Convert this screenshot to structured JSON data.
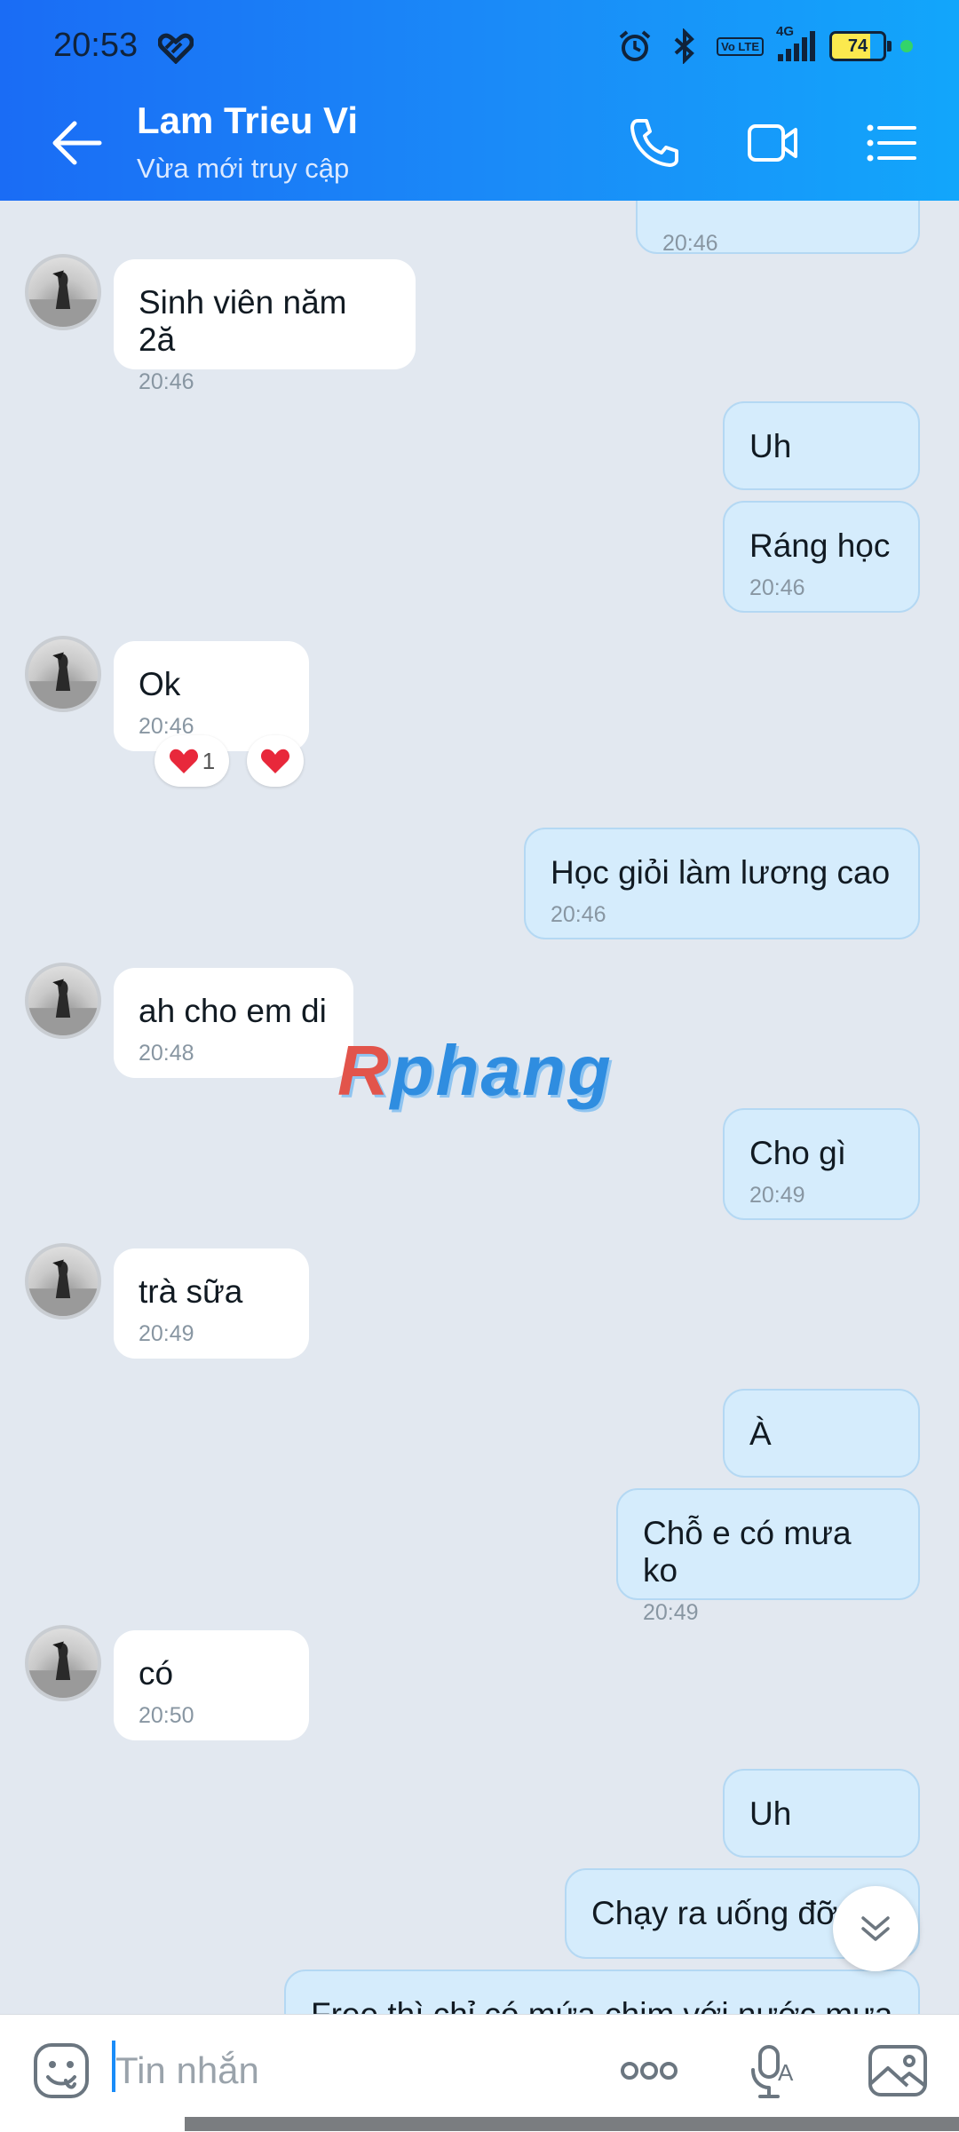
{
  "status_bar": {
    "time": "20:53",
    "network": "4G",
    "volte": "Vo LTE",
    "battery": "74"
  },
  "header": {
    "contact_name": "Lam Trieu Vi",
    "contact_status": "Vừa mới truy cập"
  },
  "messages": [
    {
      "side": "sent",
      "text": "",
      "time": "20:46"
    },
    {
      "side": "recv",
      "text": "Sinh viên năm 2ă",
      "time": "20:46"
    },
    {
      "side": "sent",
      "text": "Uh",
      "time": ""
    },
    {
      "side": "sent",
      "text": "Ráng học",
      "time": "20:46"
    },
    {
      "side": "recv",
      "text": "Ok",
      "time": "20:46",
      "reactions": [
        "❤️ 1",
        "❤️"
      ]
    },
    {
      "side": "sent",
      "text": "Học giỏi làm lương cao",
      "time": "20:46"
    },
    {
      "side": "recv",
      "text": "ah cho em di",
      "time": "20:48"
    },
    {
      "side": "sent",
      "text": "Cho gì",
      "time": "20:49"
    },
    {
      "side": "recv",
      "text": "trà sữa",
      "time": "20:49"
    },
    {
      "side": "sent",
      "text": "À",
      "time": ""
    },
    {
      "side": "sent",
      "text": "Chỗ e có mưa ko",
      "time": "20:49"
    },
    {
      "side": "recv",
      "text": "có",
      "time": "20:50"
    },
    {
      "side": "sent",
      "text": "Uh",
      "time": ""
    },
    {
      "side": "sent",
      "text": "Chạy ra uống đỡ",
      "time": ""
    },
    {
      "side": "sent",
      "text": "Free thì chỉ có mứa chim với nước mưa",
      "time": ""
    }
  ],
  "reaction_count": "1",
  "watermark": {
    "first": "R",
    "rest": "phang"
  },
  "composer": {
    "placeholder": "Tin nhắn"
  },
  "colors": {
    "header_start": "#1a6cf5",
    "header_end": "#12a6fb",
    "chat_bg": "#e2e8f0",
    "sent_bubble": "#d5ecfc",
    "recv_bubble": "#ffffff"
  },
  "icons": [
    "back-arrow-icon",
    "phone-icon",
    "video-call-icon",
    "menu-list-icon",
    "sticker-icon",
    "more-icon",
    "voice-to-text-icon",
    "image-icon",
    "chevron-down-icon",
    "heart-icon"
  ]
}
